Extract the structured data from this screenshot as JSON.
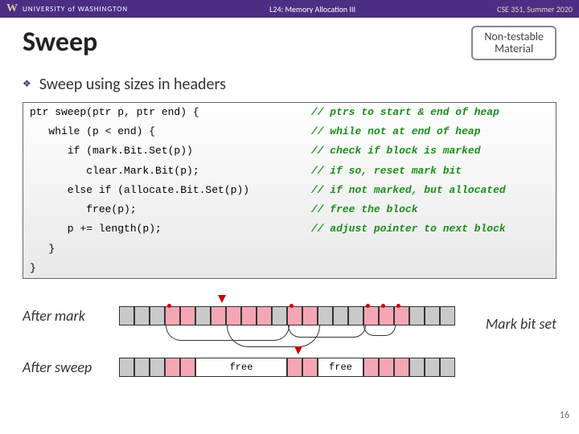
{
  "topbar": {
    "logo": "W",
    "uw": "UNIVERSITY of WASHINGTON",
    "lecture": "L24: Memory Allocation III",
    "course": "CSE 351, Summer 2020"
  },
  "title": "Sweep",
  "badge": {
    "line1": "Non-testable",
    "line2": "Material"
  },
  "subtitle": "Sweep using sizes in headers",
  "code": {
    "l1": "ptr sweep(ptr p, ptr end) {",
    "c1": "// ptrs to start & end of heap",
    "l2": "   while (p < end) {",
    "c2": "// while not at end of heap",
    "l3": "      if (mark.Bit.Set(p))",
    "c3": "// check if block is marked",
    "l4": "         clear.Mark.Bit(p);",
    "c4": "// if so, reset mark bit",
    "l5": "      else if (allocate.Bit.Set(p))",
    "c5": "// if not marked, but allocated",
    "l6": "         free(p);",
    "c6": "// free the block",
    "l7": "      p += length(p);",
    "c7": "// adjust pointer to next block",
    "l8": "   }",
    "l9": "}"
  },
  "rows": {
    "afterMark": "After mark",
    "afterSweep": "After sweep",
    "markBitSet": "Mark bit set",
    "free": "free"
  },
  "slidenum": "16"
}
